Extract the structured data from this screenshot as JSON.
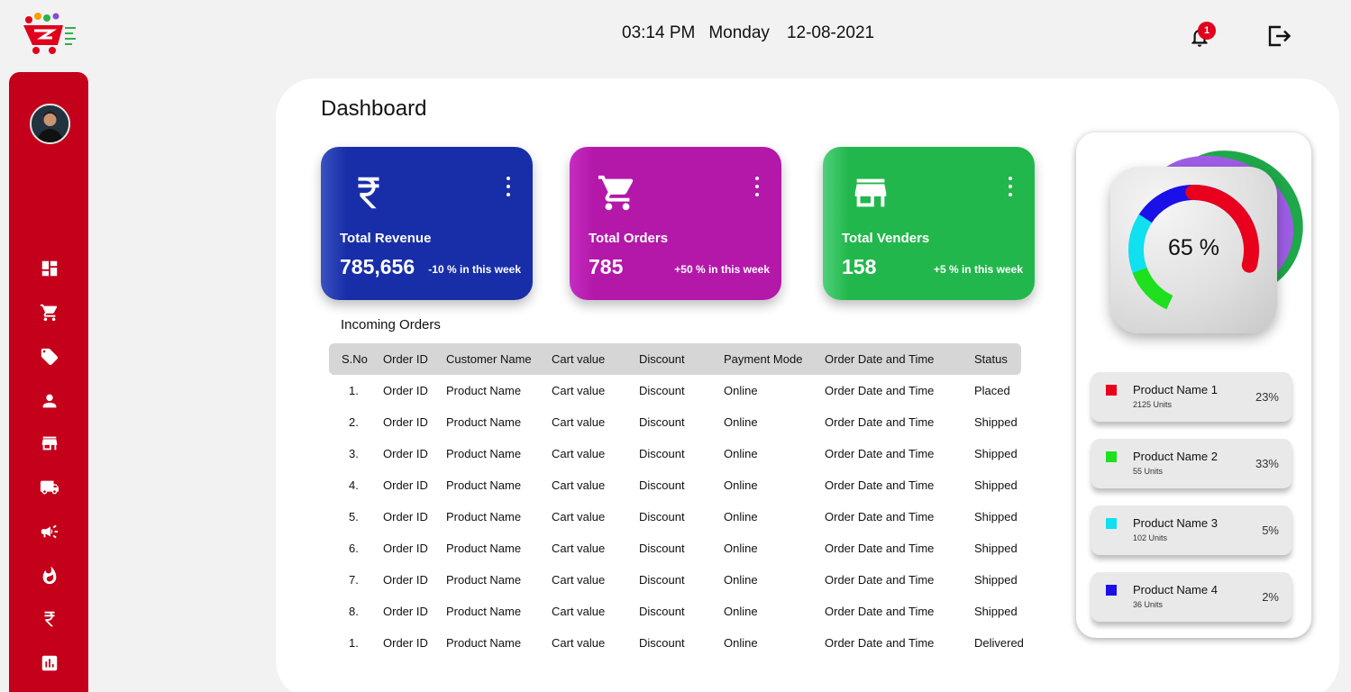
{
  "header": {
    "time": "03:14 PM",
    "day": "Monday",
    "date": "12-08-2021",
    "notification_count": "1"
  },
  "icons": {
    "logo": "shopping-cart-logo",
    "notification": "bell-icon",
    "logout": "logout-icon"
  },
  "sidebar": {
    "items": [
      {
        "icon": "dashboard-icon"
      },
      {
        "icon": "cart-icon"
      },
      {
        "icon": "tag-icon"
      },
      {
        "icon": "person-icon"
      },
      {
        "icon": "store-icon"
      },
      {
        "icon": "truck-icon"
      },
      {
        "icon": "megaphone-icon"
      },
      {
        "icon": "fire-icon"
      },
      {
        "icon": "rupee-icon"
      },
      {
        "icon": "bar-chart-icon"
      }
    ],
    "color": "#c4001a"
  },
  "main": {
    "title": "Dashboard",
    "cards": [
      {
        "label": "Total Revenue",
        "value": "785,656",
        "change": "-10 % in this week",
        "icon": "rupee-icon",
        "color": "#182ea8"
      },
      {
        "label": "Total Orders",
        "value": "785",
        "change": "+50 % in this week",
        "icon": "cart-icon",
        "color": "#b318a9"
      },
      {
        "label": "Total Venders",
        "value": "158",
        "change": "+5 % in this week",
        "icon": "store-icon",
        "color": "#22b74c"
      }
    ],
    "orders_title": "Incoming Orders",
    "table": {
      "columns": [
        "S.No",
        "Order ID",
        "Customer Name",
        "Cart value",
        "Discount",
        "Payment Mode",
        "Order Date and Time",
        "Status"
      ],
      "rows": [
        [
          "1.",
          "Order ID",
          "Product Name",
          "Cart value",
          "Discount",
          "Online",
          "Order Date and Time",
          "Placed"
        ],
        [
          "2.",
          "Order ID",
          "Product Name",
          "Cart value",
          "Discount",
          "Online",
          "Order Date and Time",
          "Shipped"
        ],
        [
          "3.",
          "Order ID",
          "Product Name",
          "Cart value",
          "Discount",
          "Online",
          "Order Date and Time",
          "Shipped"
        ],
        [
          "4.",
          "Order ID",
          "Product Name",
          "Cart value",
          "Discount",
          "Online",
          "Order Date and Time",
          "Shipped"
        ],
        [
          "5.",
          "Order ID",
          "Product Name",
          "Cart value",
          "Discount",
          "Online",
          "Order Date and Time",
          "Shipped"
        ],
        [
          "6.",
          "Order ID",
          "Product Name",
          "Cart value",
          "Discount",
          "Online",
          "Order Date and Time",
          "Shipped"
        ],
        [
          "7.",
          "Order ID",
          "Product Name",
          "Cart value",
          "Discount",
          "Online",
          "Order Date and Time",
          "Shipped"
        ],
        [
          "8.",
          "Order ID",
          "Product Name",
          "Cart value",
          "Discount",
          "Online",
          "Order Date and Time",
          "Shipped"
        ],
        [
          "1.",
          "Order ID",
          "Product Name",
          "Cart value",
          "Discount",
          "Online",
          "Order Date and Time",
          "Delivered"
        ]
      ]
    }
  },
  "right_panel": {
    "donut_label": "65 %",
    "legend": [
      {
        "name": "Product Name 1",
        "units": "2125 Units",
        "percent": "23%",
        "color": "#e8001c"
      },
      {
        "name": "Product Name 2",
        "units": "55 Units",
        "percent": "33%",
        "color": "#1ee01e"
      },
      {
        "name": "Product Name 3",
        "units": "102 Units",
        "percent": "5%",
        "color": "#10e0f0"
      },
      {
        "name": "Product Name 4",
        "units": "36 Units",
        "percent": "2%",
        "color": "#1a10e8"
      }
    ]
  }
}
